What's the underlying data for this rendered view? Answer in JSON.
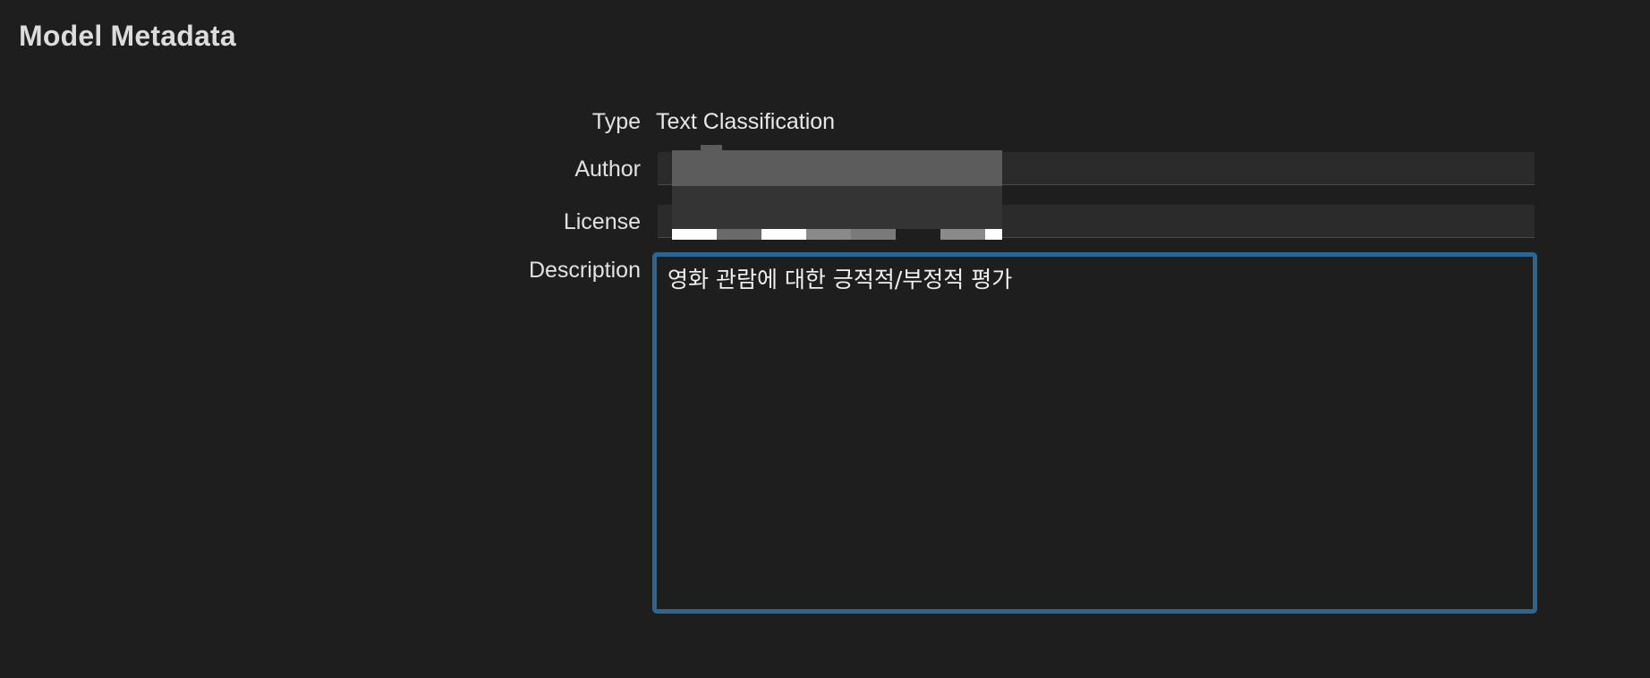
{
  "section": {
    "title": "Model Metadata"
  },
  "fields": {
    "type_label": "Type",
    "type_value": "Text Classification",
    "author_label": "Author",
    "author_value": "",
    "license_label": "License",
    "license_value": "",
    "description_label": "Description",
    "description_value": "영화 관람에 대한 긍적적/부정적 평가"
  },
  "colors": {
    "background": "#1e1e1e",
    "focus_ring": "#2b6591",
    "field_background": "#2a2a2a"
  }
}
